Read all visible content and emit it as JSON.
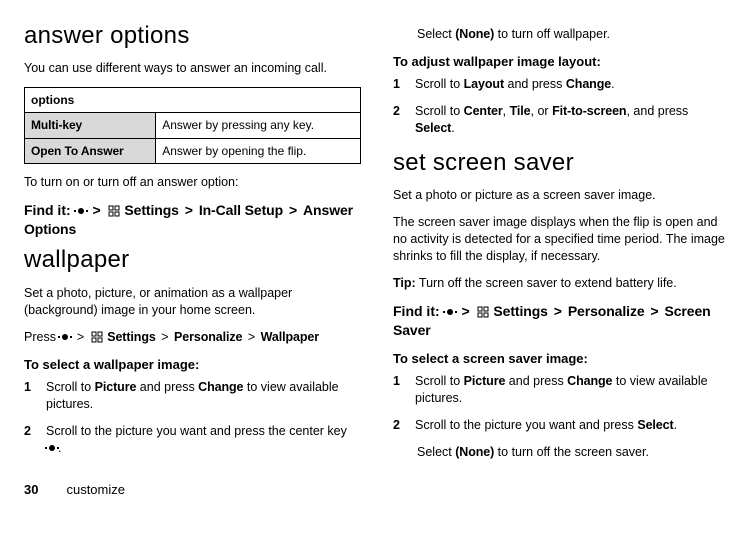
{
  "left": {
    "h_answer": "answer options",
    "p_intro": "You can use different ways to answer an incoming call.",
    "table": {
      "header": "options",
      "rows": [
        {
          "opt": "Multi-key",
          "desc": "Answer by pressing any key."
        },
        {
          "opt": "Open To Answer",
          "desc": "Answer by opening the flip."
        }
      ]
    },
    "p_turn": "To turn on or turn off an answer option:",
    "findit_label": "Find it:",
    "gt": ">",
    "path1_settings": "Settings",
    "path1_incall": "In-Call Setup",
    "path1_answer": "Answer Options",
    "h_wallpaper": "wallpaper",
    "p_wall_intro": "Set a photo, picture, or animation as a wallpaper (background) image in your home screen.",
    "press_label": "Press",
    "path2_settings": "Settings",
    "path2_personalize": "Personalize",
    "path2_wallpaper": "Wallpaper",
    "sub_select_wall": "To select a wallpaper image",
    "colon": ":",
    "steps_wall": [
      {
        "n": "1",
        "a": "Scroll to ",
        "b": "Picture",
        "c": " and press ",
        "d": "Change",
        "e": " to view available pictures."
      },
      {
        "n": "2",
        "a": "Scroll to the picture you want and press the center key ",
        "period": "."
      }
    ]
  },
  "right": {
    "p_none_wall_a": "Select ",
    "none": "(None)",
    "p_none_wall_b": " to turn off wallpaper.",
    "sub_adjust": "To adjust wallpaper image layout",
    "colon": ":",
    "steps_layout": [
      {
        "n": "1",
        "a": "Scroll to ",
        "b": "Layout",
        "c": " and press ",
        "d": "Change",
        "e": "."
      },
      {
        "n": "2",
        "a": "Scroll to ",
        "b": "Center",
        "comma1": ", ",
        "c": "Tile",
        "comma2": ", or ",
        "d": "Fit-to-screen",
        "e": ", and press ",
        "f": "Select",
        "g": "."
      }
    ],
    "h_saver": "set screen saver",
    "p_saver_intro": "Set a photo or picture as a screen saver image.",
    "p_saver_desc": "The screen saver image displays when the flip is open and no activity is detected for a specified time period. The image shrinks to fill the display, if necessary.",
    "tip_label": "Tip:",
    "tip_text": " Turn off the screen saver to extend battery life.",
    "findit_label": "Find it:",
    "gt": ">",
    "path3_settings": "Settings",
    "path3_personalize": "Personalize",
    "path3_saver": "Screen Saver",
    "sub_select_saver": "To select a screen saver image",
    "steps_saver": [
      {
        "n": "1",
        "a": "Scroll to ",
        "b": "Picture",
        "c": " and press ",
        "d": "Change",
        "e": " to view available pictures."
      },
      {
        "n": "2",
        "a": "Scroll to the picture you want and press ",
        "b": "Select",
        "c": "."
      }
    ],
    "p_none_saver_a": "Select ",
    "p_none_saver_b": " to turn off the screen saver."
  },
  "footer": {
    "page": "30",
    "section": "customize"
  }
}
